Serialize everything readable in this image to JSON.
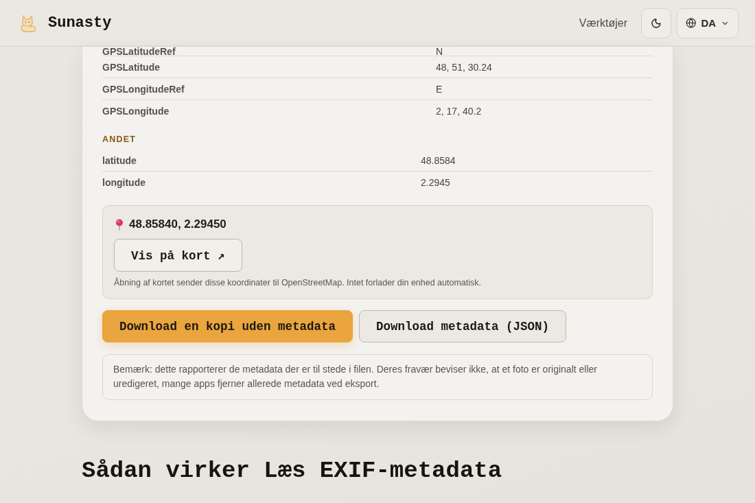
{
  "header": {
    "brand": "Sunasty",
    "nav_link": "Værktøjer",
    "language": "DA"
  },
  "metadata": {
    "sections": [
      {
        "rows": [
          {
            "key": "GPSLatitudeRef",
            "value": "N"
          },
          {
            "key": "GPSLatitude",
            "value": "48, 51, 30.24"
          },
          {
            "key": "GPSLongitudeRef",
            "value": "E"
          },
          {
            "key": "GPSLongitude",
            "value": "2, 17, 40.2"
          }
        ]
      },
      {
        "title": "ANDET",
        "rows": [
          {
            "key": "latitude",
            "value": "48.8584"
          },
          {
            "key": "longitude",
            "value": "2.2945"
          }
        ]
      }
    ]
  },
  "location": {
    "coordinates": "48.85840, 2.29450",
    "map_button": "Vis på kort ↗",
    "privacy_note": "Åbning af kortet sender disse koordinater til OpenStreetMap. Intet forlader din enhed automatisk."
  },
  "actions": [
    {
      "label": "Download en kopi uden metadata",
      "kind": "primary"
    },
    {
      "label": "Download metadata (JSON)",
      "kind": "secondary"
    }
  ],
  "disclaimer": "Bemærk: dette rapporterer de metadata der er til stede i filen. Deres fravær beviser ikke, at et foto er originalt eller uredigeret, mange apps fjerner allerede metadata ved eksport.",
  "heading": "Sådan virker Læs EXIF-metadata"
}
